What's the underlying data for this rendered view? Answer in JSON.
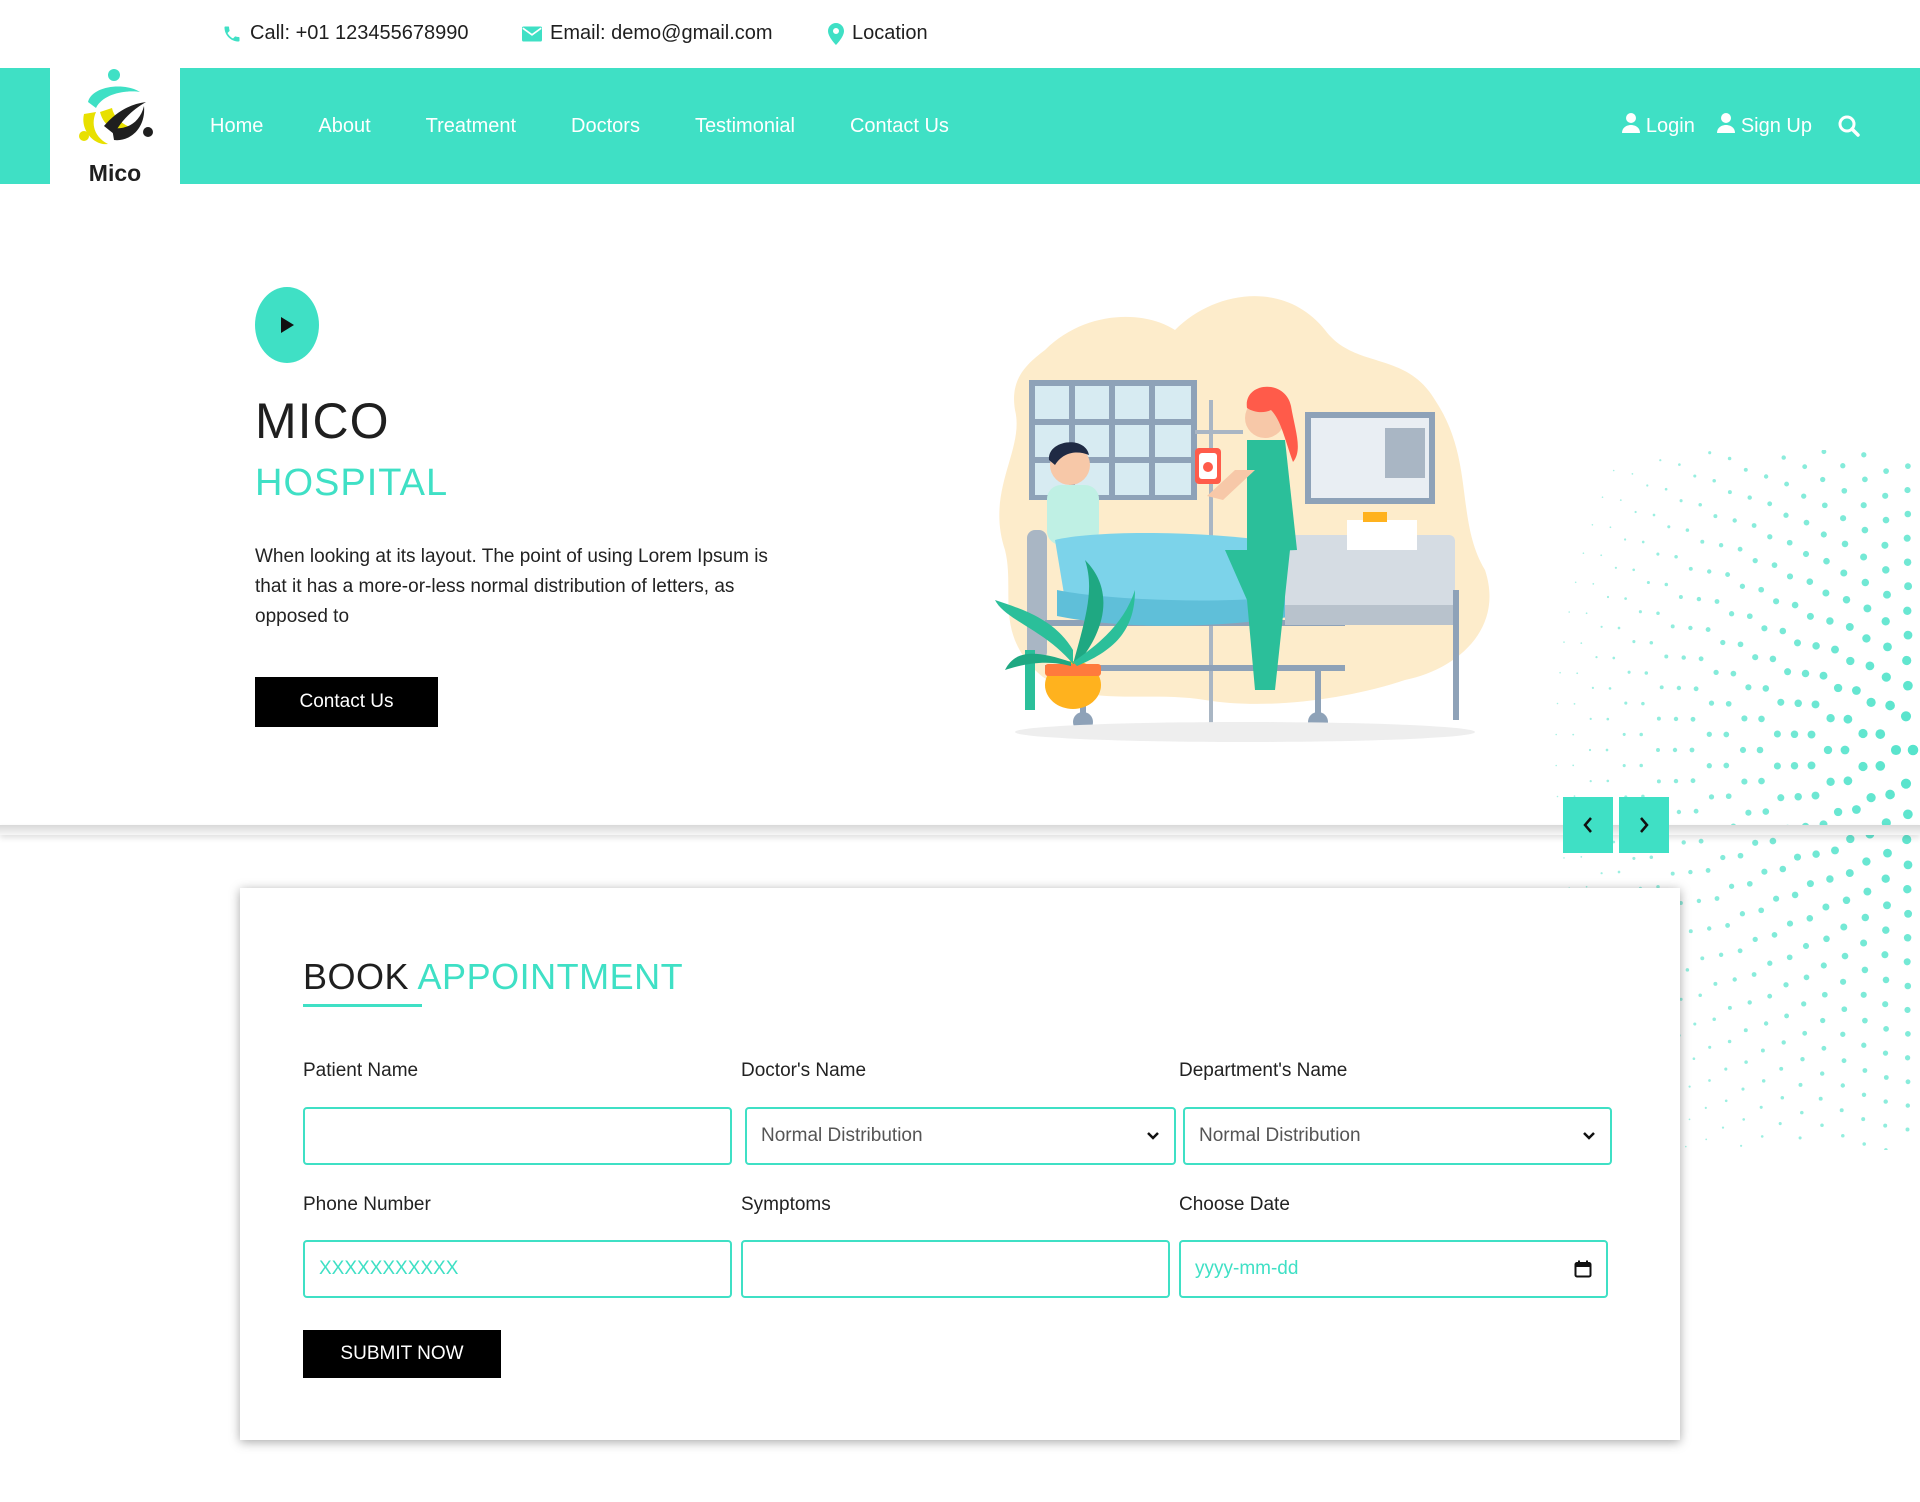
{
  "topbar": {
    "call": "Call: +01 123455678990",
    "email": "Email: demo@gmail.com",
    "location": "Location"
  },
  "logo": {
    "text": "Mico"
  },
  "nav": {
    "items": [
      "Home",
      "About",
      "Treatment",
      "Doctors",
      "Testimonial",
      "Contact Us"
    ],
    "login": "Login",
    "signup": "Sign Up"
  },
  "hero": {
    "title": "MICO",
    "subtitle": "HOSPITAL",
    "description": "When looking at its layout. The point of using Lorem Ipsum is that it has a more-or-less normal distribution of letters, as opposed to",
    "button": "Contact Us"
  },
  "booking": {
    "title_main": "BOOK",
    "title_accent": "APPOINTMENT",
    "fields": [
      {
        "label": "Patient Name",
        "value": "",
        "placeholder": ""
      },
      {
        "label": "Doctor's Name",
        "value": "Normal Distribution",
        "placeholder": ""
      },
      {
        "label": "Department's Name",
        "value": "Normal Distribution",
        "placeholder": ""
      },
      {
        "label": "Phone Number",
        "value": "",
        "placeholder": "XXXXXXXXXXX"
      },
      {
        "label": "Symptoms",
        "value": "",
        "placeholder": ""
      },
      {
        "label": "Choose Date",
        "value": "",
        "placeholder": "yyyy-mm-dd"
      }
    ],
    "submit": "SUBMIT NOW"
  },
  "colors": {
    "accent": "#3fe0c5",
    "dark": "#000000",
    "text": "#1f1f1f"
  },
  "icons": [
    "phone-icon",
    "envelope-icon",
    "map-pin-icon",
    "user-icon",
    "search-icon",
    "play-icon",
    "chevron-left-icon",
    "chevron-right-icon",
    "chevron-down-icon",
    "calendar-icon"
  ]
}
